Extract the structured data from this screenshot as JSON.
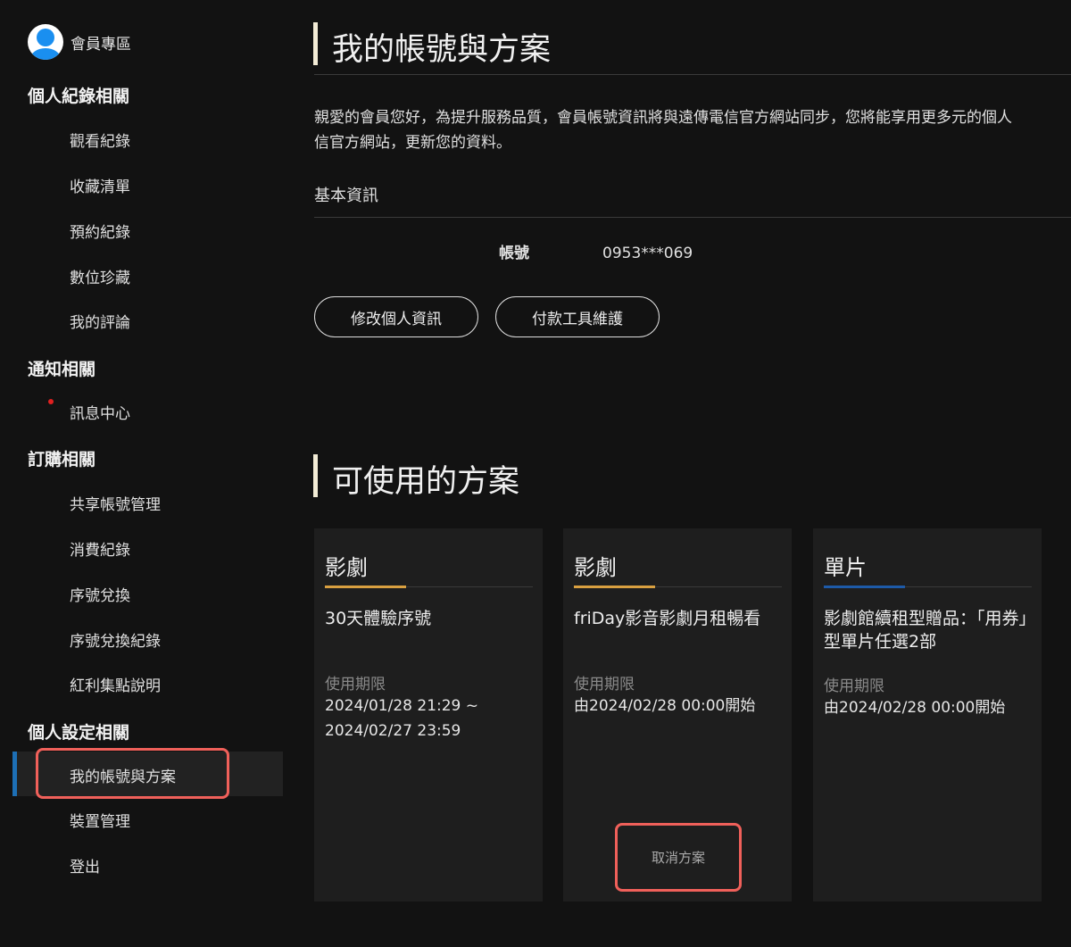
{
  "sidebar": {
    "member_label": "會員專區",
    "sections": [
      {
        "title": "個人紀錄相關",
        "items": [
          "觀看紀錄",
          "收藏清單",
          "預約紀錄",
          "數位珍藏",
          "我的評論"
        ]
      },
      {
        "title": "通知相關",
        "items": [
          "訊息中心"
        ]
      },
      {
        "title": "訂購相關",
        "items": [
          "共享帳號管理",
          "消費紀錄",
          "序號兌換",
          "序號兌換紀錄",
          "紅利集點說明"
        ]
      },
      {
        "title": "個人設定相關",
        "items": [
          "我的帳號與方案",
          "裝置管理",
          "登出"
        ]
      }
    ]
  },
  "main": {
    "title": "我的帳號與方案",
    "intro_line1": "親愛的會員您好，為提升服務品質，會員帳號資訊將與遠傳電信官方網站同步，您將能享用更多元的個人",
    "intro_line2": "信官方網站，更新您的資料。",
    "basic_info": "基本資訊",
    "account_label": "帳號",
    "account_value": "0953***069",
    "edit_button": "修改個人資訊",
    "payment_button": "付款工具維護",
    "plans_title": "可使用的方案",
    "plans": [
      {
        "category": "影劇",
        "accent": "#d9a040",
        "name": "30天體驗序號",
        "period_label": "使用期限",
        "period": [
          "2024/01/28 21:29 ~",
          "2024/02/27 23:59"
        ]
      },
      {
        "category": "影劇",
        "accent": "#d9a040",
        "name": "friDay影音影劇月租暢看",
        "period_label": "使用期限",
        "period": [
          "由2024/02/28 00:00開始"
        ],
        "action": "取消方案"
      },
      {
        "category": "單片",
        "accent": "#1d5aa8",
        "name": "影劇館續租型贈品：「用券」型單片任選2部",
        "period_label": "使用期限",
        "period": [
          "由2024/02/28 00:00開始"
        ]
      }
    ]
  }
}
